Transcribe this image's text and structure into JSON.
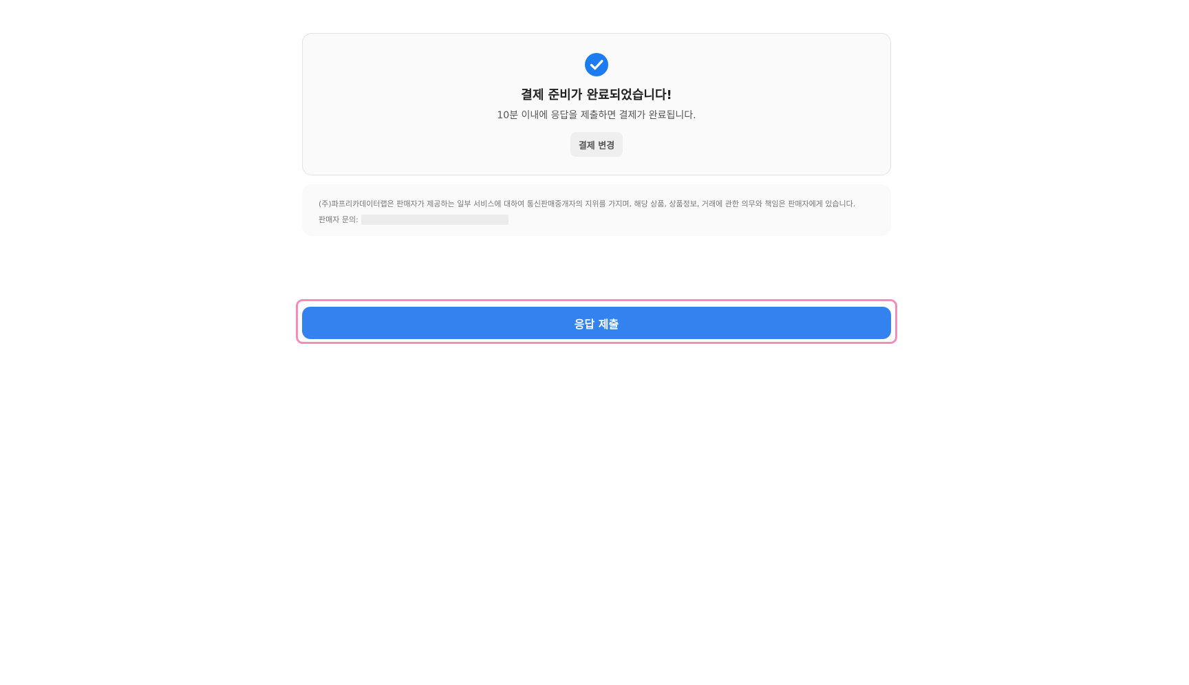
{
  "confirmation": {
    "icon": "check-circle-icon",
    "title": "결제 준비가 완료되었습니다!",
    "subtitle": "10분 이내에 응답을 제출하면 결제가 완료됩니다.",
    "change_button_label": "결제 변경"
  },
  "notice": {
    "disclaimer": "(주)파프리카데이터랩은 판매자가 제공하는 일부 서비스에 대하여 통신판매중개자의 지위를 가지며, 해당 상품, 상품정보, 거래에 관한 의무와 책임은 판매자에게 있습니다.",
    "contact_label": "판매자 문의:"
  },
  "submit": {
    "label": "응답 제출"
  },
  "colors": {
    "accent": "#3482f0",
    "highlight": "#f58cb8"
  }
}
